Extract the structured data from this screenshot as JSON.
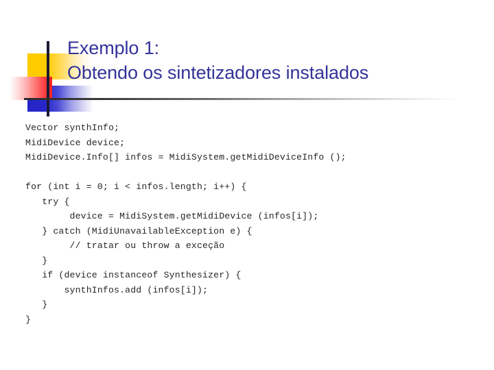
{
  "slide": {
    "title": {
      "line1": "Exemplo 1:",
      "line2": "Obtendo os sintetizadores instalados"
    },
    "decoration": {
      "yellow_color": "#ffcc00",
      "red_color": "#fa2020",
      "blue_color": "#2626c8",
      "line_color": "#1a1a33"
    },
    "title_color": "#333399",
    "rule_color": "#2b2b2b",
    "code": {
      "lines": [
        "Vector synthInfo;",
        "MidiDevice device;",
        "MidiDevice.Info[] infos = MidiSystem.getMidiDeviceInfo ();",
        "",
        "for (int i = 0; i < infos.length; i++) {",
        "   try {",
        "        device = MidiSystem.getMidiDevice (infos[i]);",
        "   } catch (MidiUnavailableException e) {",
        "        // tratar ou throw a exceção",
        "   }",
        "   if (device instanceof Synthesizer) {",
        "       synthInfos.add (infos[i]);",
        "   }",
        "}"
      ]
    }
  }
}
